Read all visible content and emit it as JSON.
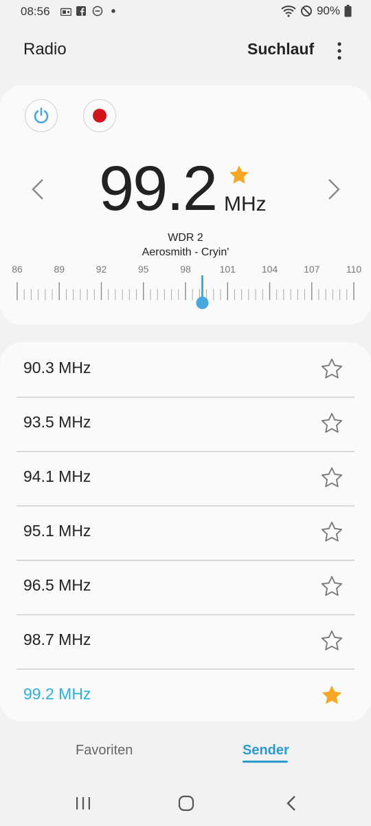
{
  "status_bar": {
    "time": "08:56",
    "battery": "90%",
    "icons": [
      "radio-notification-icon",
      "facebook-icon",
      "do-not-disturb-icon",
      "dot-icon",
      "wifi-icon",
      "no-sim-icon",
      "battery-icon"
    ]
  },
  "appbar": {
    "title": "Radio",
    "scan_label": "Suchlauf",
    "more_icon": "more-vert-icon"
  },
  "tuner": {
    "frequency": "99.2",
    "unit": "MHz",
    "favorite": true,
    "station_name": "WDR 2",
    "now_playing": "Aerosmith - Cryin'",
    "scale_labels": [
      "86",
      "89",
      "92",
      "95",
      "98",
      "101",
      "104",
      "107",
      "110"
    ],
    "scale_min": 86,
    "scale_max": 110,
    "current_value": 99.2,
    "colors": {
      "accent": "#4aa7dc",
      "star": "#f5a623",
      "record": "#d0141a"
    }
  },
  "stations": [
    {
      "label": "90.3 MHz",
      "favorite": false,
      "active": false
    },
    {
      "label": "93.5 MHz",
      "favorite": false,
      "active": false
    },
    {
      "label": "94.1 MHz",
      "favorite": false,
      "active": false
    },
    {
      "label": "95.1 MHz",
      "favorite": false,
      "active": false
    },
    {
      "label": "96.5 MHz",
      "favorite": false,
      "active": false
    },
    {
      "label": "98.7 MHz",
      "favorite": false,
      "active": false
    },
    {
      "label": "99.2 MHz",
      "favorite": true,
      "active": true
    }
  ],
  "tabs": {
    "favorites": "Favoriten",
    "stations": "Sender",
    "selected": "stations"
  },
  "navbar": {
    "icons": [
      "recent-apps-icon",
      "home-icon",
      "back-icon"
    ]
  }
}
